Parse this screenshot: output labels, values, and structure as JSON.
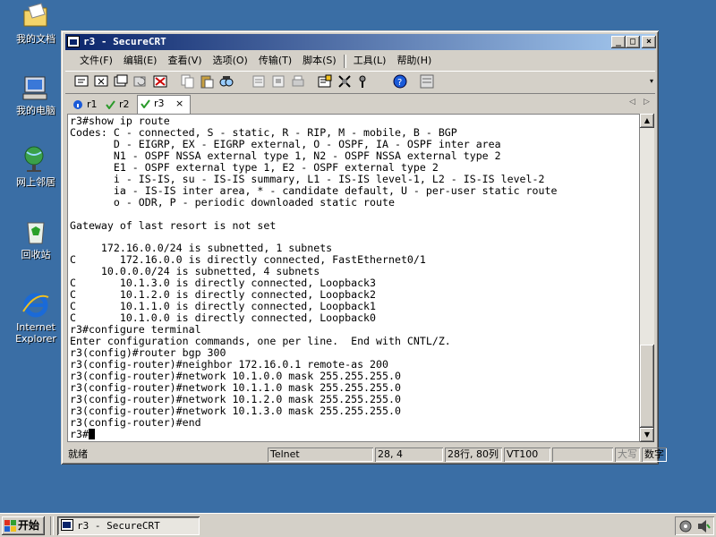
{
  "desktop": {
    "icons": [
      {
        "label": "我的文档"
      },
      {
        "label": "我的电脑"
      },
      {
        "label": "网上邻居"
      },
      {
        "label": "回收站"
      },
      {
        "label": "Internet Explorer"
      }
    ]
  },
  "window": {
    "title": "r3 - SecureCRT",
    "menu": [
      "文件(F)",
      "编辑(E)",
      "查看(V)",
      "选项(O)",
      "传输(T)",
      "脚本(S)",
      "工具(L)",
      "帮助(H)"
    ],
    "tabs": [
      {
        "label": "r1",
        "status": "info"
      },
      {
        "label": "r2",
        "status": "connected"
      },
      {
        "label": "r3",
        "status": "connected",
        "active": true
      }
    ],
    "tab_close": "×"
  },
  "terminal": {
    "lines": [
      "r3#show ip route",
      "Codes: C - connected, S - static, R - RIP, M - mobile, B - BGP",
      "       D - EIGRP, EX - EIGRP external, O - OSPF, IA - OSPF inter area",
      "       N1 - OSPF NSSA external type 1, N2 - OSPF NSSA external type 2",
      "       E1 - OSPF external type 1, E2 - OSPF external type 2",
      "       i - IS-IS, su - IS-IS summary, L1 - IS-IS level-1, L2 - IS-IS level-2",
      "       ia - IS-IS inter area, * - candidate default, U - per-user static route",
      "       o - ODR, P - periodic downloaded static route",
      "",
      "Gateway of last resort is not set",
      "",
      "     172.16.0.0/24 is subnetted, 1 subnets",
      "C       172.16.0.0 is directly connected, FastEthernet0/1",
      "     10.0.0.0/24 is subnetted, 4 subnets",
      "C       10.1.3.0 is directly connected, Loopback3",
      "C       10.1.2.0 is directly connected, Loopback2",
      "C       10.1.1.0 is directly connected, Loopback1",
      "C       10.1.0.0 is directly connected, Loopback0",
      "r3#configure terminal",
      "Enter configuration commands, one per line.  End with CNTL/Z.",
      "r3(config)#router bgp 300",
      "r3(config-router)#neighbor 172.16.0.1 remote-as 200",
      "r3(config-router)#network 10.1.0.0 mask 255.255.255.0",
      "r3(config-router)#network 10.1.1.0 mask 255.255.255.0",
      "r3(config-router)#network 10.1.2.0 mask 255.255.255.0",
      "r3(config-router)#network 10.1.3.0 mask 255.255.255.0",
      "r3(config-router)#end",
      "r3#"
    ]
  },
  "statusbar": {
    "ready": "就绪",
    "protocol": "Telnet",
    "cursor_pos": "28,  4",
    "rows_cols": "28行, 80列",
    "emulation": "VT100",
    "caps": "大写",
    "num": "数字"
  },
  "taskbar": {
    "start": "开始",
    "task": "r3 - SecureCRT"
  },
  "colors": {
    "desktop": "#3a6ea5",
    "title_start": "#0a246a",
    "title_end": "#a6caf0",
    "face": "#d4d0c8"
  }
}
